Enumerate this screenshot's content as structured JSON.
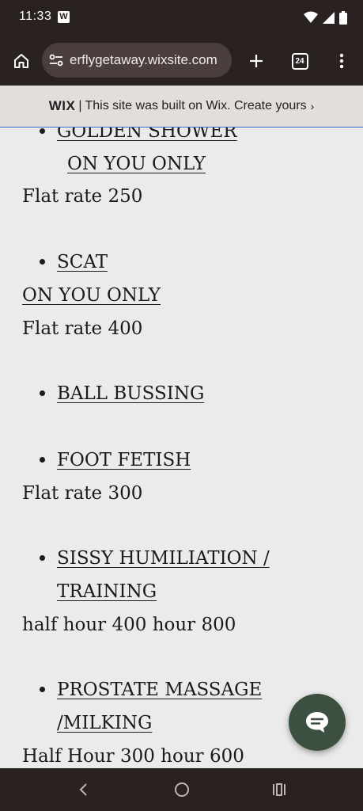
{
  "status_bar": {
    "time": "11:33",
    "badge": "W",
    "icons": [
      "wifi-icon",
      "signal-icon",
      "battery-icon"
    ]
  },
  "browser": {
    "url": "erflygetaway.wixsite.com",
    "tab_count": "24"
  },
  "wix_banner": {
    "logo": "WIX",
    "separator": "|",
    "text": "This site was built on Wix. Create yours"
  },
  "content": {
    "golden_shower": "GOLDEN SHOWER ",
    "golden_sub": "ON YOU ONLY",
    "golden_price": "Flat rate 250",
    "scat": " SCAT",
    "scat_sub": "ON YOU ONLY ",
    "scat_price": " Flat rate 400",
    "ball_bussing": "BALL BUSSING ",
    "foot_fetish": "FOOT FETISH ",
    "foot_price": " Flat rate 300",
    "sissy_1": "SISSY HUMILIATION /",
    "sissy_2": "TRAINING",
    "sissy_price": "half hour 400 hour 800",
    "prostate_1": "PROSTATE MASSAGE",
    "prostate_2": "/MILKING ",
    "prostate_price": "Half Hour 300 hour 600"
  },
  "colors": {
    "system_bar": "#2a2221",
    "url_pill": "#4a3f3c",
    "page_bg": "#ebebeb",
    "banner_bg": "#e3dedb",
    "chat_button": "#3c5042"
  }
}
